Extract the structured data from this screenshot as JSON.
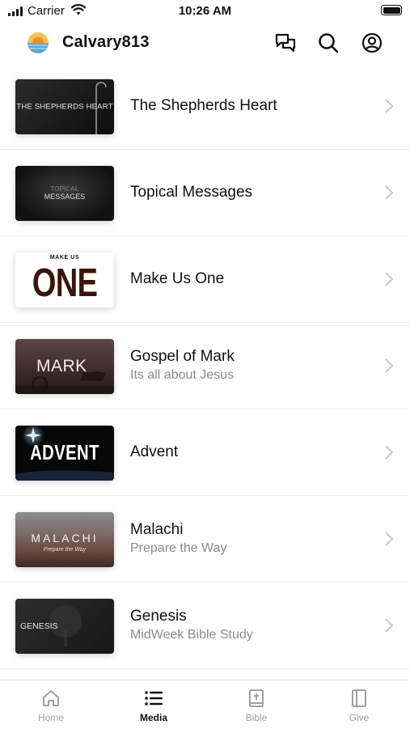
{
  "status_bar": {
    "carrier": "Carrier",
    "time": "10:26 AM"
  },
  "header": {
    "title": "Calvary813"
  },
  "series": [
    {
      "title": "The Shepherds Heart",
      "subtitle": "",
      "thumb_text": "THE SHEPHERDS HEART"
    },
    {
      "title": "Topical Messages",
      "subtitle": "",
      "thumb_text": "MESSAGES",
      "thumb_text_small": "TOPICAL"
    },
    {
      "title": "Make Us One",
      "subtitle": "",
      "thumb_text": "ONE",
      "thumb_text_small": "MAKE US"
    },
    {
      "title": "Gospel of Mark",
      "subtitle": "Its all about Jesus",
      "thumb_text": "MARK"
    },
    {
      "title": "Advent",
      "subtitle": "",
      "thumb_text": "ADVENT"
    },
    {
      "title": "Malachi",
      "subtitle": "Prepare the Way",
      "thumb_text": "MALACHI",
      "thumb_text_small": "Prepare the Way"
    },
    {
      "title": "Genesis",
      "subtitle": "MidWeek Bible Study",
      "thumb_text": "GENESIS"
    }
  ],
  "tabs": [
    {
      "label": "Home",
      "icon": "home-icon"
    },
    {
      "label": "Media",
      "icon": "list-icon",
      "active": true
    },
    {
      "label": "Bible",
      "icon": "bible-icon"
    },
    {
      "label": "Give",
      "icon": "give-icon"
    }
  ]
}
